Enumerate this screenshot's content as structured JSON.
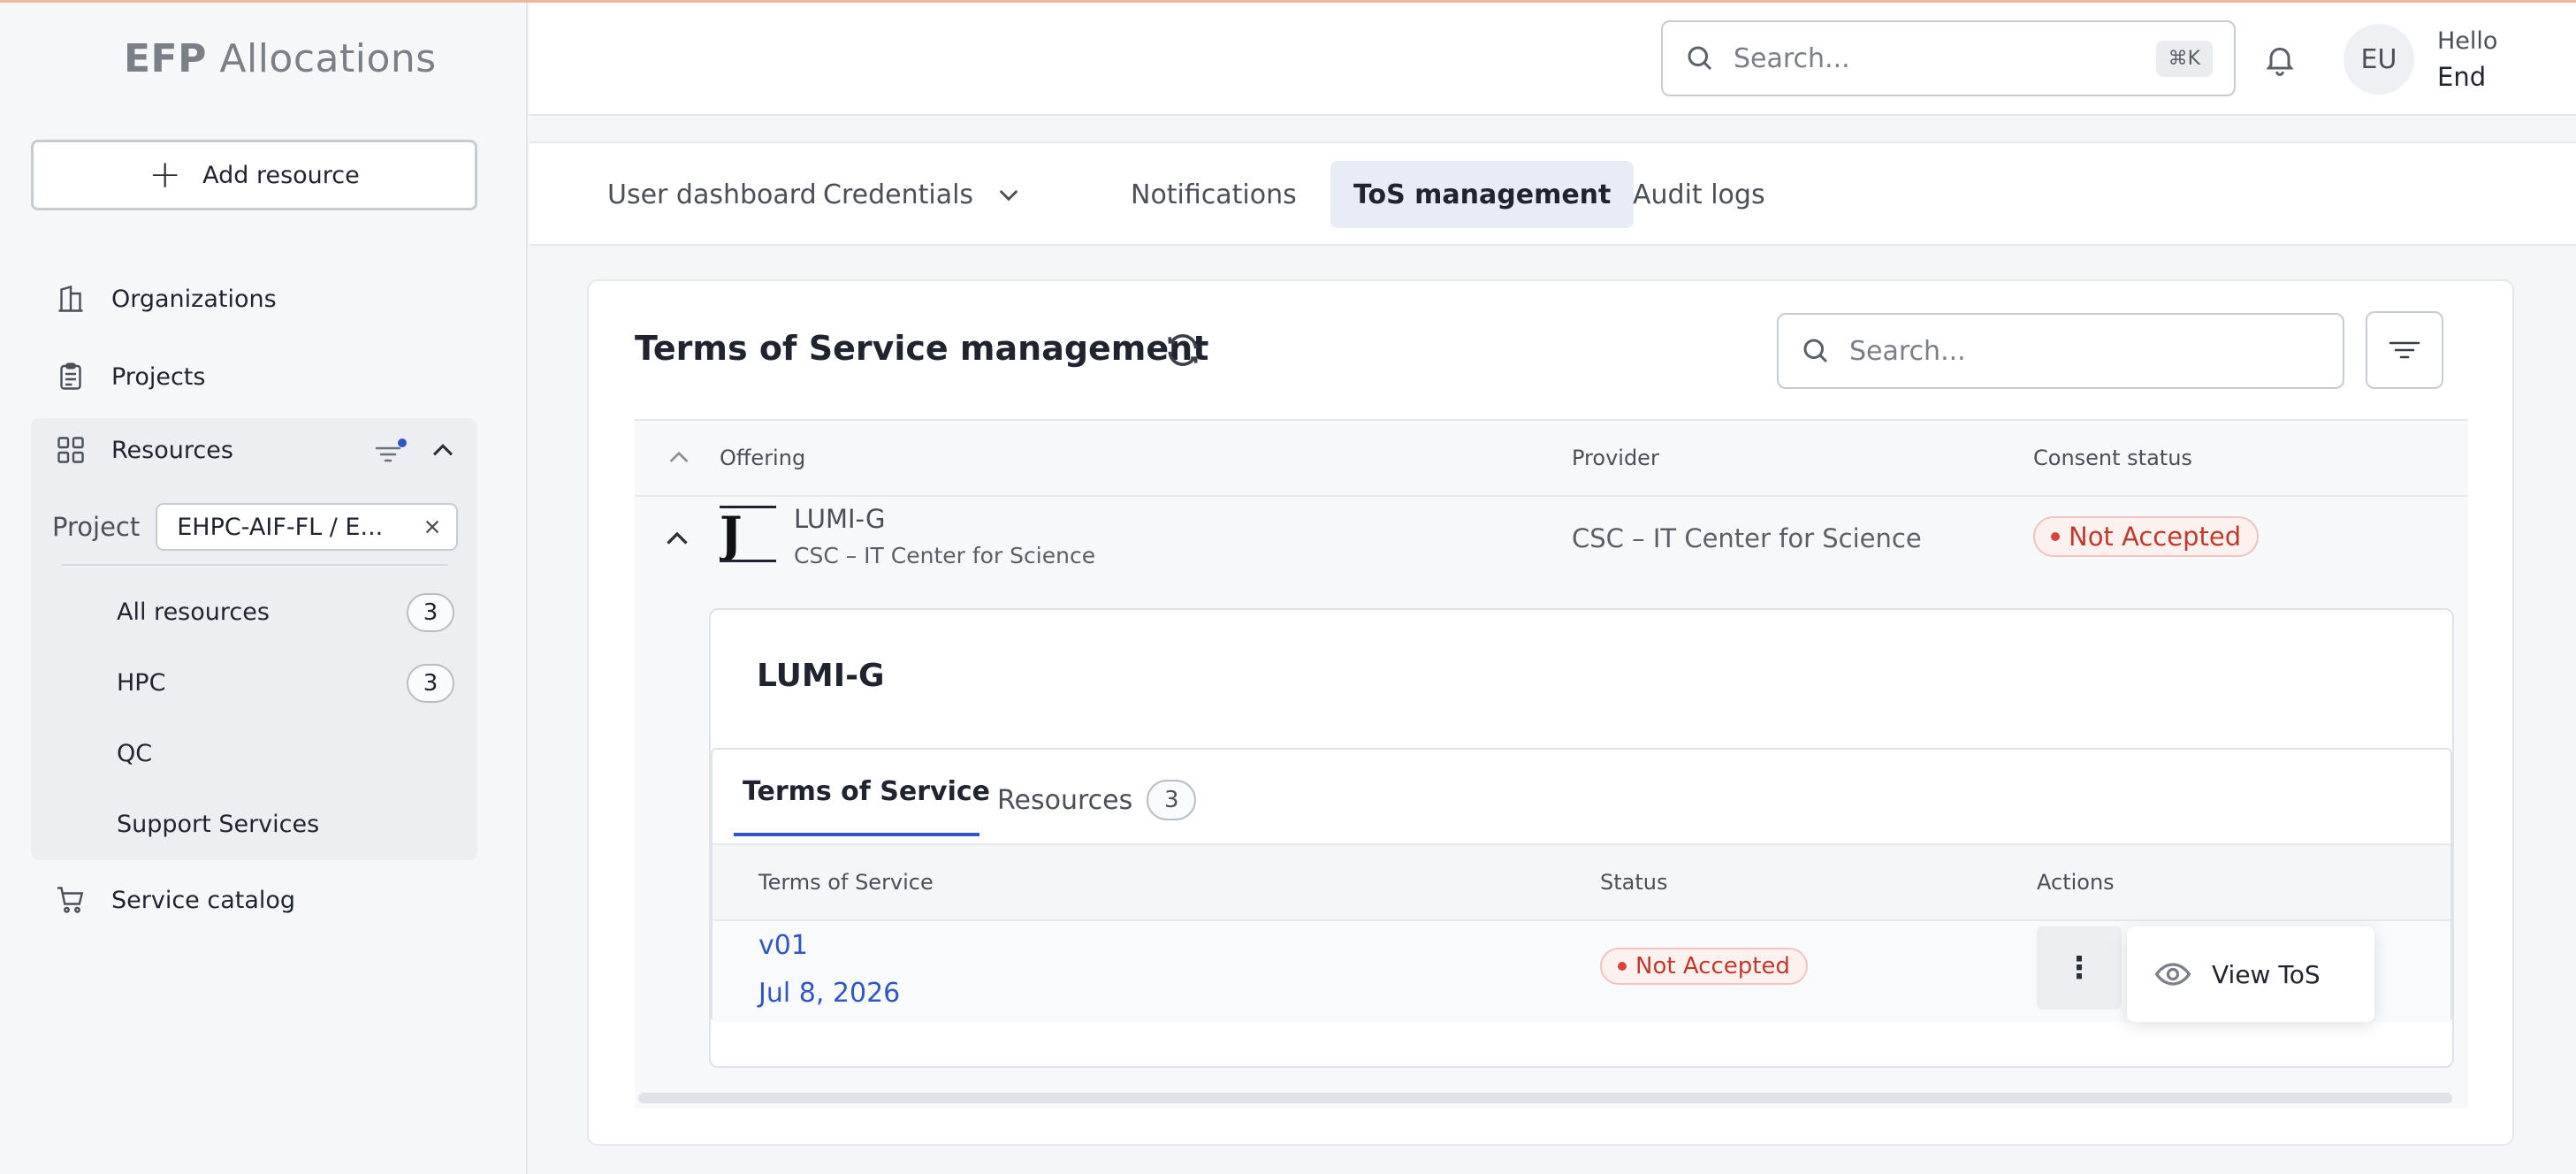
{
  "app": {
    "logo_bold": "EFP",
    "logo_rest": "Allocations"
  },
  "sidebar": {
    "add_resource_label": "Add resource",
    "items": [
      {
        "label": "Organizations",
        "icon": "building-icon"
      },
      {
        "label": "Projects",
        "icon": "clipboard-icon"
      },
      {
        "label": "Resources",
        "icon": "grid-icon"
      },
      {
        "label": "Service catalog",
        "icon": "cart-icon"
      }
    ],
    "project_label": "Project",
    "project_value": "EHPC-AIF-FL / E...",
    "resource_subitems": [
      {
        "label": "All resources",
        "count": "3"
      },
      {
        "label": "HPC",
        "count": "3"
      },
      {
        "label": "QC"
      },
      {
        "label": "Support Services"
      }
    ]
  },
  "header": {
    "search_placeholder": "Search...",
    "shortcut": "⌘K",
    "avatar_initials": "EU",
    "greeting": "Hello",
    "user_name": "End"
  },
  "tabs": [
    {
      "label": "User dashboard"
    },
    {
      "label": "Credentials"
    },
    {
      "label": "Notifications"
    },
    {
      "label": "ToS management",
      "active": true
    },
    {
      "label": "Audit logs"
    }
  ],
  "card": {
    "title": "Terms of Service management",
    "search_placeholder": "Search...",
    "columns": {
      "offering": "Offering",
      "provider": "Provider",
      "consent": "Consent status"
    },
    "row": {
      "logo_text": "J I",
      "offering_name": "LUMI-G",
      "offering_org": "CSC – IT Center for Science",
      "provider": "CSC – IT Center for Science",
      "consent_status": "Not Accepted"
    },
    "detail": {
      "title": "LUMI-G",
      "tabs": {
        "tos": "Terms of Service",
        "resources": "Resources",
        "resources_count": "3"
      },
      "columns": {
        "tos": "Terms of Service",
        "status": "Status",
        "actions": "Actions"
      },
      "tos_row": {
        "version": "v01",
        "date": "Jul 8, 2026",
        "status": "Not Accepted",
        "kebab": "⋮",
        "menu_item": "View ToS"
      }
    }
  },
  "colors": {
    "accent": "#2f56c6",
    "danger": "#c0392b",
    "active_tab_bg": "#e7ecf7"
  }
}
